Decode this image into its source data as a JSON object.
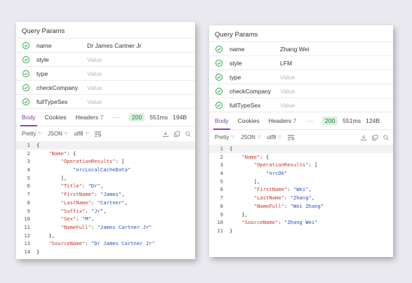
{
  "panels": [
    {
      "query_title": "Query Params",
      "params": [
        {
          "name": "name",
          "value": "Dr James Cartner Jr",
          "placeholder": false
        },
        {
          "name": "style",
          "value": "Value",
          "placeholder": true
        },
        {
          "name": "type",
          "value": "Value",
          "placeholder": true
        },
        {
          "name": "checkCompany",
          "value": "Value",
          "placeholder": true
        },
        {
          "name": "fullTypeSex",
          "value": "Value",
          "placeholder": true
        }
      ],
      "tabs": {
        "body": "Body",
        "cookies": "Cookies",
        "headers": "Headers",
        "headers_count": "7",
        "more": "···"
      },
      "status": {
        "code": "200",
        "time": "551ms",
        "size": "194B"
      },
      "toolbar": {
        "format": "Pretty",
        "type": "JSON",
        "encoding": "utf8"
      },
      "code_lines": [
        "{",
        "    \"Name\": {",
        "        \"OperationResults\": [",
        "            \"nrcLocalCacheData\"",
        "        ],",
        "        \"Title\": \"Dr\",",
        "        \"FirstName\": \"James\",",
        "        \"LastName\": \"Cartner\",",
        "        \"Suffix\": \"Jr\",",
        "        \"Sex\": \"M\",",
        "        \"NameFull\": \"James Cartner Jr\"",
        "    },",
        "    \"SourceName\": \"Dr James Cartner Jr\"",
        "}"
      ]
    },
    {
      "query_title": "Query Params",
      "params": [
        {
          "name": "name",
          "value": "Zhang Wei",
          "placeholder": false
        },
        {
          "name": "style",
          "value": "LFM",
          "placeholder": false
        },
        {
          "name": "type",
          "value": "Value",
          "placeholder": true
        },
        {
          "name": "checkCompany",
          "value": "Value",
          "placeholder": true
        },
        {
          "name": "fullTypeSex",
          "value": "Value",
          "placeholder": true
        }
      ],
      "tabs": {
        "body": "Body",
        "cookies": "Cookies",
        "headers": "Headers",
        "headers_count": "7",
        "more": "···"
      },
      "status": {
        "code": "200",
        "time": "551ms",
        "size": "124B"
      },
      "toolbar": {
        "format": "Pretty",
        "type": "JSON",
        "encoding": "utf8"
      },
      "code_lines": [
        "{",
        "    \"Name\": {",
        "        \"OperationResults\": [",
        "            \"nrcOk\"",
        "        ],",
        "        \"FirstName\": \"Wei\",",
        "        \"LastName\": \"Zhang\",",
        "        \"NameFull\": \"Wei Zhang\"",
        "    },",
        "    \"SourceName\": \"Zhang Wei\"",
        "}"
      ]
    }
  ],
  "colors": {
    "accent": "#8e44ad",
    "status_bg": "#d9f2dd",
    "status_fg": "#1e7a34",
    "check": "#2da44e",
    "json_key": "#c0392b",
    "json_string": "#2a4fb8"
  }
}
